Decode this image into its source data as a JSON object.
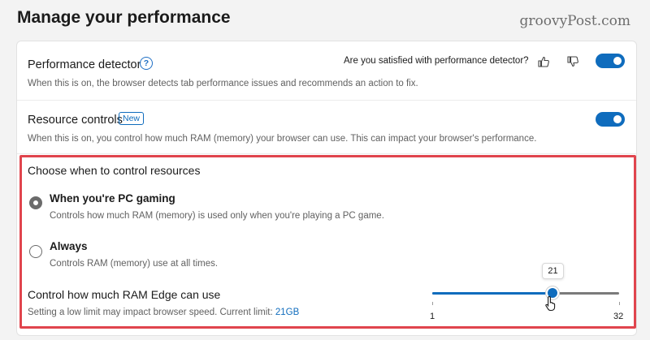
{
  "page": {
    "title": "Manage your performance",
    "watermark": "groovyPost.com"
  },
  "performance_detector": {
    "title": "Performance detector",
    "description": "When this is on, the browser detects tab performance issues and recommends an action to fix.",
    "feedback_question": "Are you satisfied with performance detector?",
    "toggle_on": true
  },
  "resource_controls": {
    "title": "Resource controls",
    "badge": "New",
    "description": "When this is on, you control how much RAM (memory) your browser can use. This can impact your browser's performance.",
    "toggle_on": true
  },
  "choose_section": {
    "title": "Choose when to control resources",
    "options": [
      {
        "label": "When you're PC gaming",
        "description": "Controls how much RAM (memory) is used only when you're playing a PC game.",
        "selected": true
      },
      {
        "label": "Always",
        "description": "Controls RAM (memory) use at all times.",
        "selected": false
      }
    ]
  },
  "ram_control": {
    "title": "Control how much RAM Edge can use",
    "description_prefix": "Setting a low limit may impact browser speed. Current limit:",
    "current_limit": "21GB",
    "slider": {
      "min": 1,
      "max": 32,
      "value": 21,
      "min_label": "1",
      "max_label": "32",
      "tooltip": "21"
    }
  },
  "colors": {
    "accent": "#0f6cbd",
    "highlight": "#e0444d"
  },
  "icons": [
    "help-icon",
    "thumbs-up-icon",
    "thumbs-down-icon",
    "mouse-pointer-hand-icon"
  ]
}
